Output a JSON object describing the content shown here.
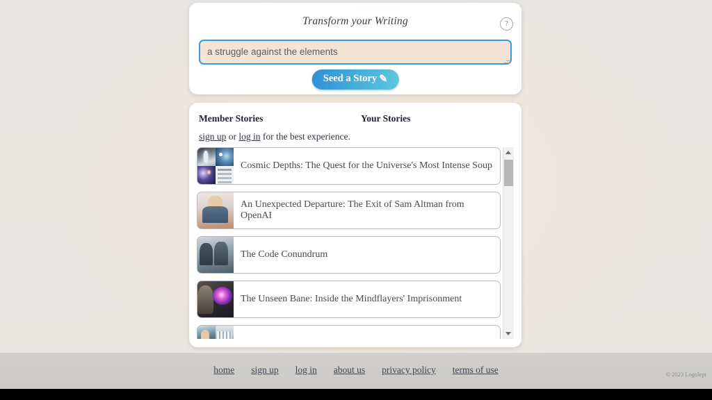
{
  "prompt": {
    "title": "Transform your Writing",
    "help_icon": "help-circle-icon",
    "input_value": "a struggle against the elements",
    "input_placeholder": "a struggle against the elements",
    "seed_button_label": "Seed a Story",
    "seed_button_icon": "quill-pen-icon",
    "accent_color": "#3a9ad9",
    "input_background": "#f3e4d6"
  },
  "stories": {
    "tabs": [
      {
        "label": "Member Stories",
        "active": true
      },
      {
        "label": "Your Stories",
        "active": false
      }
    ],
    "notice": {
      "signup_label": "sign up",
      "middle_text": " or ",
      "login_label": "log in",
      "tail_text": " for the best experience."
    },
    "items": [
      {
        "title": "Cosmic Depths: The Quest for the Universe's Most Intense Soup",
        "thumb": "cosmic-collage-thumbnail"
      },
      {
        "title": "An Unexpected Departure: The Exit of Sam Altman from OpenAI",
        "thumb": "person-at-desk-thumbnail"
      },
      {
        "title": "The Code Conundrum",
        "thumb": "two-developers-thumbnail"
      },
      {
        "title": "The Unseen Bane: Inside the Mindflayers' Imprisonment",
        "thumb": "glowing-brain-thumbnail"
      },
      {
        "title": "",
        "thumb": "building-collage-thumbnail"
      }
    ],
    "scrollbar": {
      "up_icon": "chevron-up-icon",
      "down_icon": "chevron-down-icon"
    }
  },
  "footer": {
    "links": [
      {
        "label": "home"
      },
      {
        "label": "sign up"
      },
      {
        "label": "log in"
      },
      {
        "label": "about us"
      },
      {
        "label": "privacy policy"
      },
      {
        "label": "terms of use"
      }
    ],
    "copyright": "© 2023 Logolept"
  }
}
